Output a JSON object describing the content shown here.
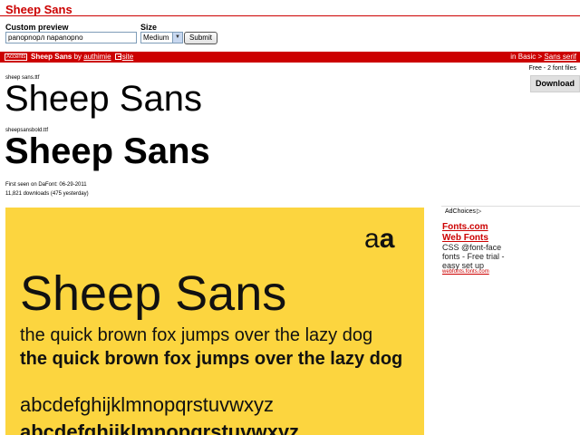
{
  "header": {
    "title": "Sheep Sans"
  },
  "form": {
    "custom_preview_label": "Custom preview",
    "custom_preview_value": "panopnopл napanopno",
    "size_label": "Size",
    "size_value": "Medium",
    "submit_label": "Submit"
  },
  "font_bar": {
    "accents_badge": "Accents",
    "font_name": "Sheep Sans",
    "by_text": "by",
    "author": "authimie",
    "site_link": "site",
    "category_prefix": "in Basic >",
    "category_link": "Sans serif"
  },
  "license": "Free - 2 font files",
  "download_label": "Download",
  "files": {
    "regular": {
      "filename": "sheep sans.ttf",
      "sample": "Sheep Sans"
    },
    "bold": {
      "filename": "sheepsansbold.ttf",
      "sample": "Sheep Sans"
    }
  },
  "meta": {
    "first_seen": "First seen on DaFont: 06-29-2011",
    "downloads": "11,821 downloads (475 yesterday)"
  },
  "ad": {
    "adchoices": "AdChoices",
    "title1": "Fonts.com",
    "title2": "Web Fonts",
    "text": "CSS @font-face fonts - Free trial - easy set up",
    "url": "webfonts.fonts.com"
  },
  "specimen": {
    "aa_regular": "a",
    "aa_bold": "a",
    "title": "Sheep Sans",
    "line_regular": "the quick brown fox jumps over the lazy dog",
    "line_bold": "the quick brown fox jumps over the lazy dog",
    "alphabet_regular": "abcdefghijklmnopqrstuvwxyz",
    "alphabet_bold": "abcdefghijklmnopqrstuvwxyz",
    "background": "#fcd53f"
  },
  "colors": {
    "accent": "#cc0000"
  }
}
